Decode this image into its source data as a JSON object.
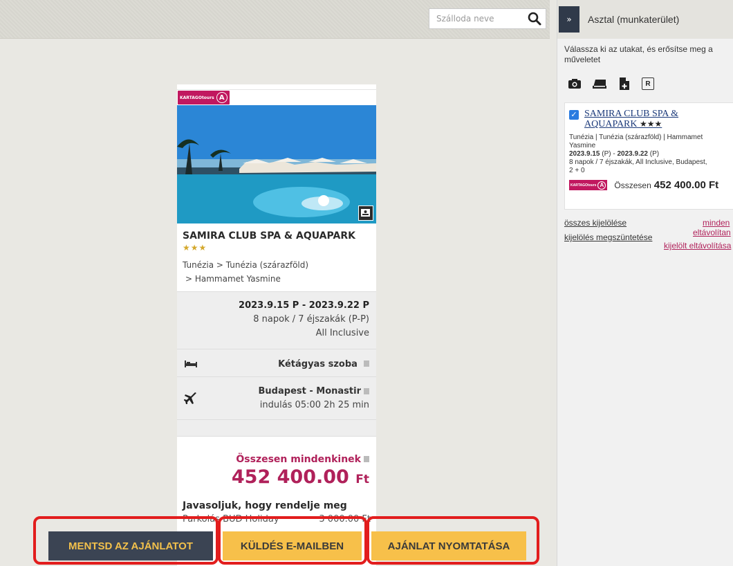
{
  "search": {
    "placeholder": "Szálloda neve",
    "icon": "search-icon"
  },
  "card": {
    "brand_text": "KARTAGOtours",
    "brand_letter": "A",
    "hotel_name": "SAMIRA CLUB SPA & AQUAPARK",
    "stars": "★★★",
    "location_line1": "Tunézia  > Tunézia (szárazföld)",
    "location_line2": "> Hammamet Yasmine",
    "dates": "2023.9.15 P - 2023.9.22 P",
    "duration": "8 napok / 7 éjszakák (P-P)",
    "board": "All Inclusive",
    "room": "Kétágyas szoba",
    "route": "Budapest - Monastir",
    "departure": "indulás 05:00   2h 25 min",
    "total_label": "Összesen mindenkinek",
    "total_amount": "452 400.00",
    "total_currency": "Ft",
    "recommend": "Javasoljuk, hogy rendelje meg",
    "extra_name": "Parkolás BUD Holiday",
    "extra_price": "3 000.00 Ft"
  },
  "actions": {
    "save": "MENTSD AZ AJÁNLATOT",
    "email": "KÜLDÉS E-MAILBEN",
    "print": "AJÁNLAT NYOMTATÁSA",
    "frame_color": "#e21d1d"
  },
  "panel": {
    "collapse": "»",
    "title": "Asztal (munkaterület)",
    "instruction_l1": "Válassza ki az utakat, és erősítse meg a",
    "instruction_l2": "műveletet",
    "tools": [
      "camera-icon",
      "folder-icon",
      "add-file-icon",
      "r-icon"
    ],
    "tool_r_label": "R",
    "item": {
      "name_l1": "SAMIRA CLUB SPA &",
      "name_l2": "AQUAPARK",
      "stars": "★★★",
      "location_l1": "Tunézia | Tunézia (szárazföld) | Hammamet",
      "location_l2": "Yasmine",
      "date_from": "2023.9.15",
      "date_from_day": " (P) - ",
      "date_to": "2023.9.22",
      "date_to_day": " (P)",
      "details_l1": "8 napok / 7 éjszakák, All Inclusive, Budapest,",
      "details_l2": "2 + 0",
      "total_label": "Összesen",
      "total_amount": "452 400.00 Ft"
    },
    "links": {
      "select_all": "összes kijelölése",
      "deselect": "kijelölés megszüntetése",
      "remove_all_l1": "minden",
      "remove_all_l2": "eltávolítan",
      "remove_selected": "kijelölt eltávolítása"
    }
  },
  "colors": {
    "accent_pink": "#b0215a",
    "button_yellow": "#f7c04a",
    "button_dark": "#3b4453",
    "star_gold": "#d4a82c"
  }
}
